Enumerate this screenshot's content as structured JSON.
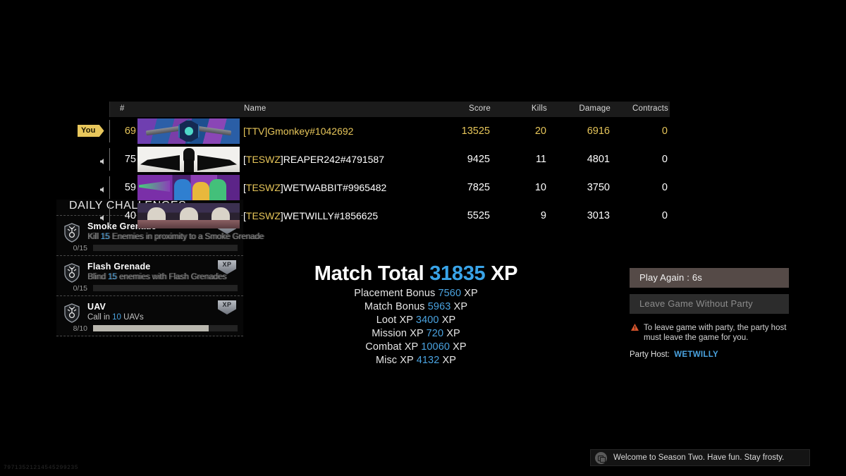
{
  "scoreboard": {
    "columns": {
      "rank": "#",
      "name": "Name",
      "score": "Score",
      "kills": "Kills",
      "damage": "Damage",
      "contracts": "Contracts"
    },
    "you_label": "You",
    "rows": [
      {
        "rank": "69",
        "tag": "TTV",
        "name": "[TTV]Gmonkey#1042692",
        "name_prefix": "[",
        "name_suffix": "]Gmonkey#1042692",
        "score": "13525",
        "kills": "20",
        "damage": "6916",
        "contracts": "0",
        "is_you": true
      },
      {
        "rank": "75",
        "tag": "TESWZ",
        "name": "[TESWZ]REAPER242#4791587",
        "name_prefix": "[",
        "name_suffix": "]REAPER242#4791587",
        "score": "9425",
        "kills": "11",
        "damage": "4801",
        "contracts": "0",
        "is_you": false
      },
      {
        "rank": "59",
        "tag": "TESWZ",
        "name": "[TESWZ]WETWABBIT#9965482",
        "name_prefix": "[",
        "name_suffix": "]WETWABBIT#9965482",
        "score": "7825",
        "kills": "10",
        "damage": "3750",
        "contracts": "0",
        "is_you": false
      },
      {
        "rank": "40",
        "tag": "TESWZ",
        "name": "[TESWZ]WETWILLY#1856625",
        "name_prefix": "[",
        "name_suffix": "]WETWILLY#1856625",
        "score": "5525",
        "kills": "9",
        "damage": "3013",
        "contracts": "0",
        "is_you": false
      }
    ]
  },
  "challenges": {
    "title": "DAILY CHALLENGES",
    "xp_badge_label": "XP",
    "items": [
      {
        "name": "Smoke Grenade",
        "desc_pre": "Kill ",
        "desc_num": "15",
        "desc_post": " Enemies in proximity to a Smoke Grenade",
        "progress_label": "0/15",
        "progress_pct": 0
      },
      {
        "name": "Flash Grenade",
        "desc_pre": "Blind ",
        "desc_num": "15",
        "desc_post": " enemies with Flash Grenades",
        "progress_label": "0/15",
        "progress_pct": 0
      },
      {
        "name": "UAV",
        "desc_pre": "Call in ",
        "desc_num": "10",
        "desc_post": " UAVs",
        "progress_label": "8/10",
        "progress_pct": 80
      }
    ]
  },
  "match_total": {
    "title_prefix": "Match Total ",
    "total": "31835",
    "title_suffix": " XP",
    "breakdown": [
      {
        "label": "Placement Bonus ",
        "value": "7560",
        "unit": " XP"
      },
      {
        "label": "Match Bonus ",
        "value": "5963",
        "unit": " XP"
      },
      {
        "label": "Loot XP ",
        "value": "3400",
        "unit": " XP"
      },
      {
        "label": "Mission XP ",
        "value": "720",
        "unit": " XP"
      },
      {
        "label": "Combat XP ",
        "value": "10060",
        "unit": " XP"
      },
      {
        "label": "Misc XP ",
        "value": "4132",
        "unit": " XP"
      }
    ]
  },
  "right_panel": {
    "play_again": "Play Again : 6s",
    "leave_game": "Leave Game Without Party",
    "warning": "To leave game with party, the party host must leave the game for you.",
    "party_host_label": "Party Host:",
    "party_host_name": "WETWILLY"
  },
  "notification": {
    "text": "Welcome to Season Two. Have fun. Stay frosty."
  },
  "watermark": "79713521214545299235",
  "colors": {
    "gold": "#e7c65a",
    "blue": "#4aa3e0",
    "warning": "#d9542b"
  }
}
